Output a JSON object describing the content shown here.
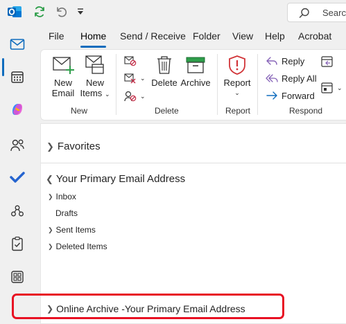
{
  "quick_access": {
    "app_icon": "outlook-icon",
    "sync_icon": "sync-icon",
    "undo_icon": "undo-icon",
    "customize_icon": "customize-icon"
  },
  "search": {
    "placeholder": "Search"
  },
  "rail": {
    "items": [
      "mail-icon",
      "calendar-icon",
      "copilot-icon",
      "people-icon",
      "todo-icon",
      "org-explorer-icon",
      "tasks-icon",
      "apps-icon"
    ]
  },
  "tabs": [
    "File",
    "Home",
    "Send / Receive",
    "Folder",
    "View",
    "Help",
    "Acrobat"
  ],
  "active_tab": "Home",
  "ribbon": {
    "new_email": [
      "New",
      "Email"
    ],
    "new_items": [
      "New",
      "Items"
    ],
    "delete": "Delete",
    "archive": "Archive",
    "report": "Report",
    "reply": "Reply",
    "reply_all": "Reply All",
    "forward": "Forward",
    "groups": {
      "new": "New",
      "delete": "Delete",
      "report": "Report",
      "respond": "Respond"
    }
  },
  "folders": {
    "favorites": "Favorites",
    "account": "Your Primary Email Address",
    "items": [
      "Inbox",
      "Drafts",
      "Sent Items",
      "Deleted Items"
    ],
    "online_archive": "Online Archive -Your Primary Email Address"
  },
  "colors": {
    "accent": "#0f6cbd",
    "highlight": "#e81123",
    "outlook_blue": "#0364b8",
    "sync_green": "#2e9e4a",
    "report_red": "#d13438"
  }
}
